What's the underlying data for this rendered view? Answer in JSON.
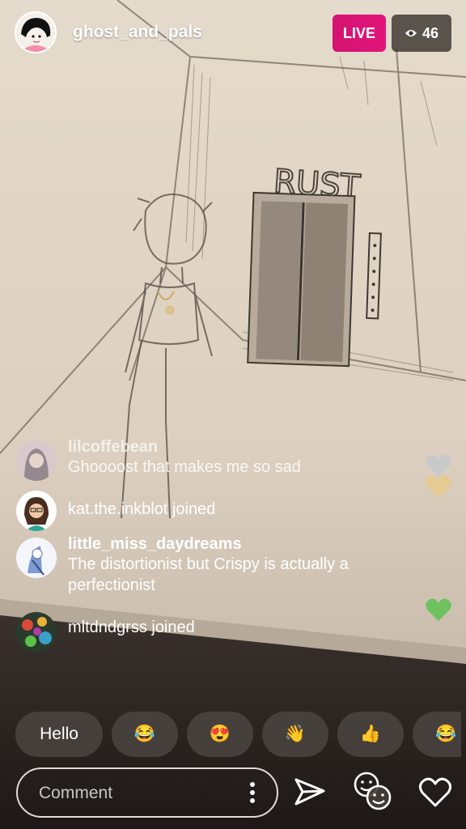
{
  "header": {
    "username": "ghost_and_pals",
    "live_label": "LIVE",
    "viewer_count": "46"
  },
  "comments": [
    {
      "type": "comment",
      "username": "lilcoffebean",
      "text": "Ghoooost that makes me so sad"
    },
    {
      "type": "join",
      "text": "kat.the.inkblot joined"
    },
    {
      "type": "comment",
      "username": "little_miss_daydreams",
      "text": "The distortionist but Crispy is actually a perfectionist"
    },
    {
      "type": "join",
      "text": "mltdndgrss joined"
    }
  ],
  "quick_reactions": [
    {
      "label": "Hello"
    },
    {
      "label": "😂"
    },
    {
      "label": "😍"
    },
    {
      "label": "👋"
    },
    {
      "label": "👍"
    },
    {
      "label": "😂😂"
    }
  ],
  "comment_input": {
    "placeholder": "Comment"
  },
  "icons": {
    "send": "send-icon",
    "emoji_faces": "emoji-faces-icon",
    "heart": "heart-icon",
    "eye": "eye-icon",
    "more": "more-vertical-icon"
  },
  "colors": {
    "live": "#e0157a",
    "floating_heart_gray": "#c5c8cc",
    "floating_heart_tan": "#e8c98a",
    "floating_heart_green": "#6dc15f"
  }
}
